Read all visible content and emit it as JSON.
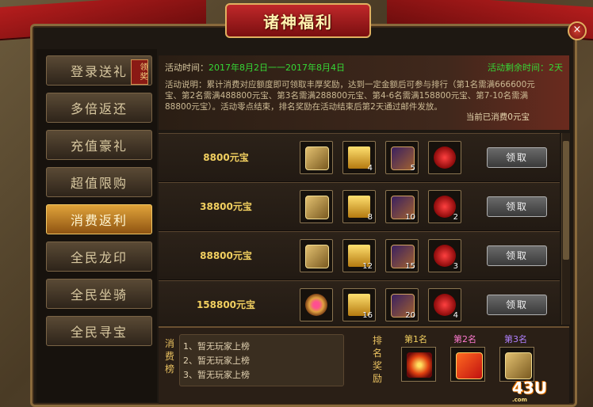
{
  "window": {
    "title": "诸神福利",
    "close_glyph": "×"
  },
  "sidebar": {
    "items": [
      {
        "label": "登录送礼",
        "badge": "领奖"
      },
      {
        "label": "多倍返还"
      },
      {
        "label": "充值豪礼"
      },
      {
        "label": "超值限购"
      },
      {
        "label": "消费返利",
        "active": true
      },
      {
        "label": "全民龙印"
      },
      {
        "label": "全民坐骑"
      },
      {
        "label": "全民寻宝"
      }
    ]
  },
  "info": {
    "time_label": "活动时间：",
    "time_value": "2017年8月2日一一2017年8月4日",
    "remaining": "活动剩余时间：2天",
    "description": "活动说明：累计消费对应额度即可领取丰厚奖励，达到一定金额后可参与排行（第1名需满666600元宝、第2名需满488800元宝、第3名需满288800元宝、第4-6名需满158800元宝、第7-10名需满88800元宝）。活动零点结束，排名奖励在活动结束后第2天通过邮件发放。",
    "current": "当前已消费0元宝"
  },
  "tiers": [
    {
      "amount": "8800元宝",
      "items": [
        {
          "icon": "chest-icon",
          "count": ""
        },
        {
          "icon": "gold-bar-icon",
          "count": "4"
        },
        {
          "icon": "box-icon",
          "count": "5"
        },
        {
          "icon": "wing-icon",
          "count": ""
        }
      ],
      "claim": "领取"
    },
    {
      "amount": "38800元宝",
      "items": [
        {
          "icon": "chest-icon",
          "count": ""
        },
        {
          "icon": "gold-bar-icon",
          "count": "8"
        },
        {
          "icon": "box-icon",
          "count": "10"
        },
        {
          "icon": "wing-icon",
          "count": "2"
        }
      ],
      "claim": "领取"
    },
    {
      "amount": "88800元宝",
      "items": [
        {
          "icon": "chest-icon",
          "count": ""
        },
        {
          "icon": "gold-bar-icon",
          "count": "12"
        },
        {
          "icon": "box-icon",
          "count": "15"
        },
        {
          "icon": "wing-icon",
          "count": "3"
        }
      ],
      "claim": "领取"
    },
    {
      "amount": "158800元宝",
      "items": [
        {
          "icon": "ring-icon",
          "count": ""
        },
        {
          "icon": "gold-bar-icon",
          "count": "16"
        },
        {
          "icon": "box-icon",
          "count": "20"
        },
        {
          "icon": "wing-icon",
          "count": "4"
        }
      ],
      "claim": "领取"
    }
  ],
  "leaderboard": {
    "title": "消费榜",
    "entries": [
      "1、暂无玩家上榜",
      "2、暂无玩家上榜",
      "3、暂无玩家上榜"
    ]
  },
  "rank_rewards": {
    "title": "排名奖励",
    "ranks": [
      {
        "label": "第1名",
        "color": "#f2d060",
        "icon": "fire-icon"
      },
      {
        "label": "第2名",
        "color": "#ff7ad0",
        "icon": "gift-icon"
      },
      {
        "label": "第3名",
        "color": "#b080ff",
        "icon": "chest-icon"
      }
    ]
  },
  "logo": {
    "text": "43U",
    "sub": ".com"
  }
}
